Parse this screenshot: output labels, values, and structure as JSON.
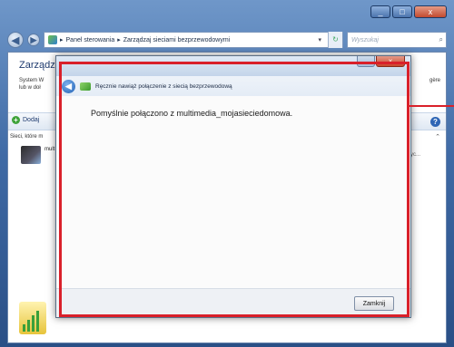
{
  "breadcrumb": {
    "items": [
      "Panel sterowania",
      "Zarządzaj sieciami bezprzewodowymi"
    ],
    "separator": "▸"
  },
  "search": {
    "placeholder": "Wyszukaj"
  },
  "outer_window": {
    "heading": "Zarządz",
    "description_left_1": "System W",
    "description_left_2": "lub w doł",
    "description_right_1": "gère",
    "add_button": "Dodaj",
    "list_header": "Sieci, które m",
    "network_name": "mult",
    "network_right_text": "utyc..."
  },
  "dialog": {
    "header_title": "Ręcznie nawiąż połączenie z siecią bezprzewodową",
    "message": "Pomyślnie połączono z multimedia_mojasieciedomowa.",
    "close_button": "Zamknij"
  },
  "colors": {
    "highlight": "#d9202a",
    "title_bar": "#3f6aa5"
  }
}
